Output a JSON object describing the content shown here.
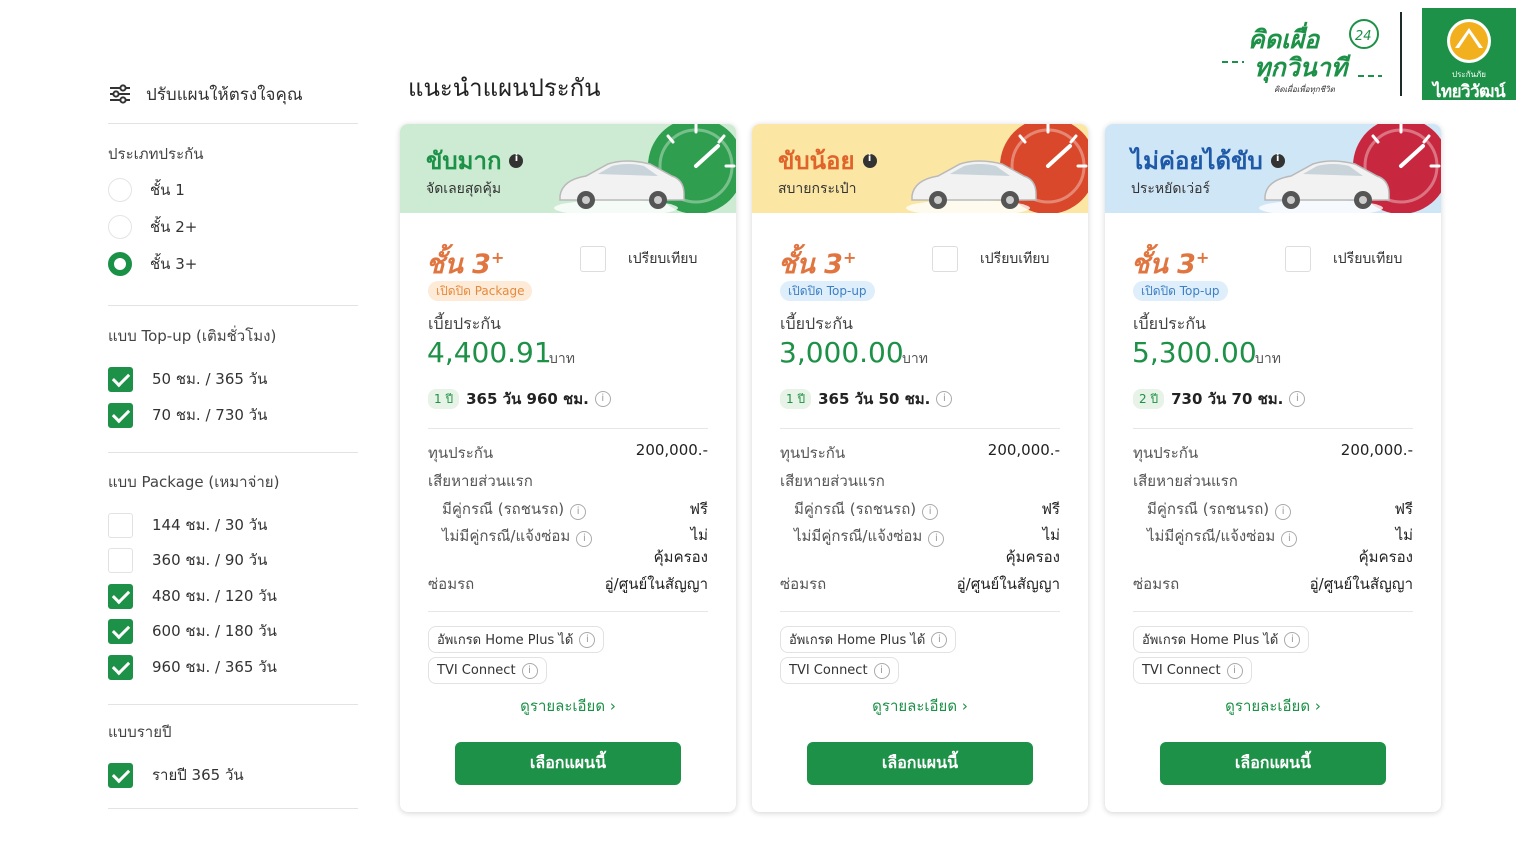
{
  "brand": {
    "slogan_line1": "คิดเผื่อ",
    "slogan_badge": "24",
    "slogan_line2": "ทุกวินาที",
    "slogan_small": "คิดเผื่อเพื่อทุกชีวิต",
    "logo_sub": "ประกันภัย",
    "logo_name": "ไทยวิวัฒน์",
    "logo_bg": "#1d9147"
  },
  "sidebar": {
    "heading": "ปรับแผนให้ตรงใจคุณ",
    "groups": [
      {
        "title": "ประเภทประกัน",
        "type": "radio",
        "options": [
          {
            "label": "ชั้น 1",
            "selected": false
          },
          {
            "label": "ชั้น 2+",
            "selected": false
          },
          {
            "label": "ชั้น 3+",
            "selected": true
          }
        ]
      },
      {
        "title": "แบบ Top-up (เติมชั่วโมง)",
        "type": "checkbox",
        "options": [
          {
            "label": "50 ชม. / 365 วัน",
            "checked": true
          },
          {
            "label": "70 ชม. / 730 วัน",
            "checked": true
          }
        ]
      },
      {
        "title": "แบบ Package (เหมาจ่าย)",
        "type": "checkbox",
        "options": [
          {
            "label": "144 ชม. / 30 วัน",
            "checked": false
          },
          {
            "label": "360 ชม. / 90 วัน",
            "checked": false
          },
          {
            "label": "480 ชม. / 120 วัน",
            "checked": true
          },
          {
            "label": "600 ชม. / 180 วัน",
            "checked": true
          },
          {
            "label": "960 ชม. / 365 วัน",
            "checked": true
          }
        ]
      },
      {
        "title": "แบบรายปี",
        "type": "checkbox",
        "options": [
          {
            "label": "รายปี 365 วัน",
            "checked": true
          }
        ]
      }
    ]
  },
  "main": {
    "title": "แนะนำแผนประกัน",
    "labels": {
      "class": "ชั้น 3",
      "class_sup": "+",
      "compare": "เปรียบเทียบ",
      "premium": "เบี้ยประกัน",
      "unit": "บาท",
      "sum_insured": "ทุนประกัน",
      "damage": "เสียหายส่วนแรก",
      "with_party": "มีคู่กรณี (รถชนรถ)",
      "no_party": "ไม่มีคู่กรณี/แจ้งซ่อม",
      "repair": "ซ่อมรถ",
      "detail_link": "ดูรายละเอียด ›",
      "choose": "เลือกแผนนี้"
    },
    "plans": [
      {
        "name": "ขับมาก",
        "subtitle": "จัดเลยสุดคุ้ม",
        "header_color": "#cdebd3",
        "gauge_color": "#2f9e4f",
        "tag": "เปิดปิด Package",
        "tag_bg": "#fdebd8",
        "tag_color": "#e58a3c",
        "price": "4,400.91",
        "years": "1 ปี",
        "duration": "365 วัน 960 ชม.",
        "sum_insured": "200,000.-",
        "with_party": "ฟรี",
        "no_party": "ไม่\nคุ้มครอง",
        "repair": "อู่/ศูนย์ในสัญญา",
        "chips": [
          "อัพเกรด Home Plus ได้",
          "TVI Connect"
        ]
      },
      {
        "name": "ขับน้อย",
        "subtitle": "สบายกระเป๋า",
        "header_color": "#fbe6a4",
        "gauge_color": "#d9482a",
        "tag": "เปิดปิด Top-up",
        "tag_bg": "#dfeefb",
        "tag_color": "#3d7fc4",
        "price": "3,000.00",
        "years": "1 ปี",
        "duration": "365 วัน 50 ชม.",
        "sum_insured": "200,000.-",
        "with_party": "ฟรี",
        "no_party": "ไม่\nคุ้มครอง",
        "repair": "อู่/ศูนย์ในสัญญา",
        "chips": [
          "อัพเกรด Home Plus ได้",
          "TVI Connect"
        ]
      },
      {
        "name": "ไม่ค่อยได้ขับ",
        "subtitle": "ประหยัดเว่อร์",
        "header_color": "#cfe6f7",
        "gauge_color": "#c8283f",
        "tag": "เปิดปิด Top-up",
        "tag_bg": "#dfeefb",
        "tag_color": "#3d7fc4",
        "price": "5,300.00",
        "years": "2 ปี",
        "duration": "730 วัน 70 ชม.",
        "sum_insured": "200,000.-",
        "with_party": "ฟรี",
        "no_party": "ไม่\nคุ้มครอง",
        "repair": "อู่/ศูนย์ในสัญญา",
        "chips": [
          "อัพเกรด Home Plus ได้",
          "TVI Connect"
        ]
      }
    ]
  }
}
